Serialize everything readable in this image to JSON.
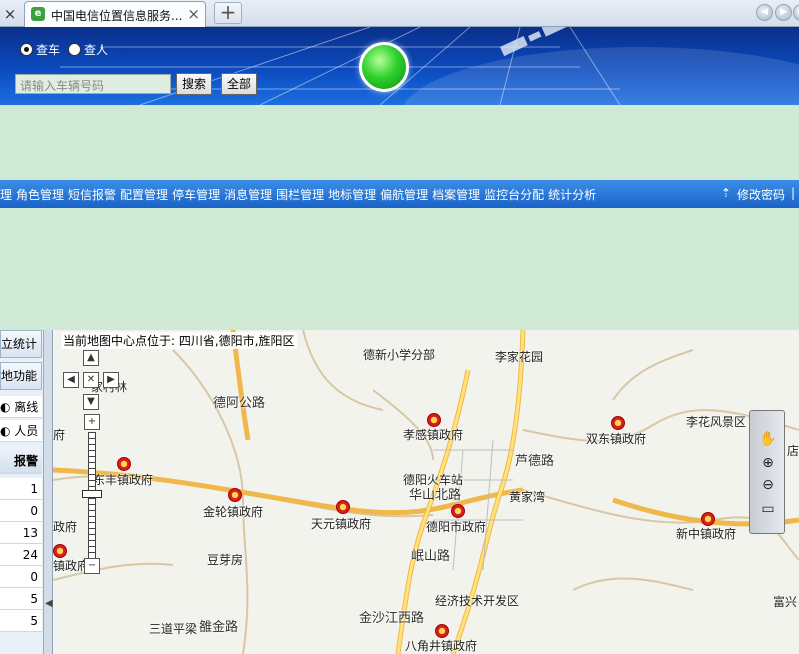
{
  "browser": {
    "tab_title": "中国电信位置信息服务...",
    "new_tab_label": "+",
    "close_glyph": "×"
  },
  "header": {
    "radio_car_label": "查车",
    "radio_person_label": "查人",
    "search_placeholder": "请输入车辆号码",
    "search_button": "搜索",
    "all_button": "全部",
    "status_color": "#2fd12c"
  },
  "menu": {
    "items": [
      "理",
      "角色管理",
      "短信报警",
      "配置管理",
      "停车管理",
      "消息管理",
      "围栏管理",
      "地标管理",
      "偏航管理",
      "档案管理",
      "监控台分配",
      "统计分析"
    ],
    "change_password": "修改密码",
    "separator": "|"
  },
  "left_panel": {
    "buttons": [
      "立统计",
      "地功能"
    ],
    "status_rows": [
      "离线",
      "人员"
    ],
    "column_header": "报警",
    "values": [
      "1",
      "0",
      "13",
      "24",
      "0",
      "5",
      "5"
    ]
  },
  "map": {
    "center_text": "当前地图中心点位于: 四川省,德阳市,旌阳区",
    "labels": {
      "l1": "德新小学分部",
      "l2": "李家花园",
      "l3": "家村林",
      "l4": "德阿公路",
      "l5": "孝感镇政府",
      "l6": "双东镇政府",
      "l7": "李花风景区",
      "l8": "店",
      "l9": "府",
      "l10": "东丰镇政府",
      "l11": "德阳火车站",
      "l12": "华山北路",
      "l13": "芦德路",
      "l14": "黄家湾",
      "l15": "金轮镇政府",
      "l16": "天元镇政府",
      "l17": "德阳市政府",
      "l18": "新中镇政府",
      "l19": "政府",
      "l20": "镇政府",
      "l21": "豆芽房",
      "l22": "岷山路",
      "l23": "经济技术开发区",
      "l24": "富兴",
      "l25": "三道平梁",
      "l26": "雒金路",
      "l27": "金沙江西路",
      "l28": "八角井镇政府"
    }
  }
}
